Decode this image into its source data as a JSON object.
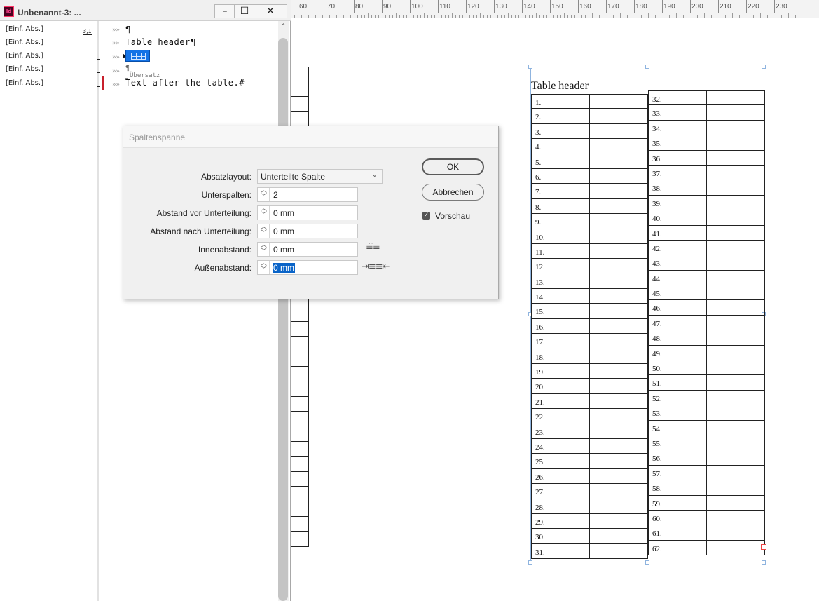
{
  "window": {
    "title": "Unbenannt-3: ...",
    "app_icon_text": "Id",
    "minimize": "–",
    "maximize": "☐",
    "close": "✕"
  },
  "ruler": {
    "labels": [
      "60",
      "70",
      "80",
      "90",
      "100",
      "110",
      "120",
      "130",
      "140",
      "150",
      "160",
      "170",
      "180",
      "190",
      "200",
      "210",
      "220",
      "230"
    ]
  },
  "story_editor": {
    "styles": [
      {
        "name": "[Einf. Abs.]",
        "depth": "3,1"
      },
      {
        "name": "[Einf. Abs.]",
        "depth": ""
      },
      {
        "name": "[Einf. Abs.]",
        "depth": ""
      },
      {
        "name": "[Einf. Abs.]",
        "depth": ""
      },
      {
        "name": "[Einf. Abs.]",
        "depth": ""
      }
    ],
    "para_marker": "»»",
    "lines": {
      "line1": "¶",
      "line2": "Table header¶",
      "line4": "¶",
      "overset_label": "Übersatz",
      "line5": "Text after the table.#"
    },
    "scroll_up": "⌃"
  },
  "document": {
    "table_header": "Table header",
    "left_column_numbers": [
      "1.",
      "2.",
      "3.",
      "4.",
      "5.",
      "6.",
      "7.",
      "8.",
      "9.",
      "10.",
      "11.",
      "12.",
      "13.",
      "14.",
      "15.",
      "16.",
      "17.",
      "18.",
      "19.",
      "20.",
      "21.",
      "22.",
      "23.",
      "24.",
      "25.",
      "26.",
      "27.",
      "28.",
      "29.",
      "30.",
      "31."
    ],
    "right_column_numbers": [
      "32.",
      "33.",
      "34.",
      "35.",
      "36.",
      "37.",
      "38.",
      "39.",
      "40.",
      "41.",
      "42.",
      "43.",
      "44.",
      "45.",
      "46.",
      "47.",
      "48.",
      "49.",
      "50.",
      "51.",
      "52.",
      "53.",
      "54.",
      "55.",
      "56.",
      "57.",
      "58.",
      "59.",
      "60.",
      "61.",
      "62."
    ]
  },
  "dialog": {
    "title": "Spaltenspanne",
    "fields": {
      "absatzlayout_label": "Absatzlayout:",
      "absatzlayout_value": "Unterteilte Spalte",
      "unterspalten_label": "Unterspalten:",
      "unterspalten_value": "2",
      "abstand_vor_label": "Abstand vor Unterteilung:",
      "abstand_vor_value": "0 mm",
      "abstand_nach_label": "Abstand nach Unterteilung:",
      "abstand_nach_value": "0 mm",
      "innenabstand_label": "Innenabstand:",
      "innenabstand_value": "0 mm",
      "aussenabstand_label": "Außenabstand:",
      "aussenabstand_value": "0 mm"
    },
    "ok_label": "OK",
    "cancel_label": "Abbrechen",
    "preview_label": "Vorschau",
    "preview_checked": true
  },
  "colors": {
    "selection_blue": "#1473e6",
    "frame_blue": "#8fb4df",
    "overset_red": "#c8202c"
  }
}
